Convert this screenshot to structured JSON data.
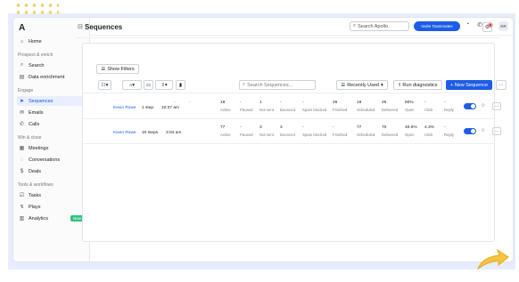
{
  "sidebar": {
    "logo": "A",
    "home": "Home",
    "sections": {
      "prospect": "Prospect & enrich",
      "engage": "Engage",
      "winclose": "Win & close",
      "tools": "Tools & workflows"
    },
    "items": {
      "search": "Search",
      "data_enrichment": "Data enrichment",
      "sequences": "Sequences",
      "emails": "Emails",
      "calls": "Calls",
      "meetings": "Meetings",
      "conversations": "Conversations",
      "deals": "Deals",
      "tasks": "Tasks",
      "plays": "Plays",
      "analytics": "Analytics",
      "analytics_badge": "New"
    }
  },
  "topbar": {
    "search_placeholder": "Search Apollo",
    "invite_label": "Invite Teammates",
    "avatar_initials": "KR"
  },
  "page": {
    "title": "Sequences",
    "show_filters": "Show Filters",
    "search_placeholder": "Search Sequences...",
    "sort_label": "Recently Used",
    "run_diagnostics": "Run diagnostics",
    "new_sequence": "+ New Sequence",
    "more": "···"
  },
  "rows": [
    {
      "owner": "Kevin Rowe",
      "steps": "1 step",
      "time": "10:37 am",
      "active": "18",
      "paused": "-",
      "not_sent": "1",
      "bounced": "-",
      "spam_blocked": "-",
      "finished": "26",
      "scheduled": "19",
      "delivered": "26",
      "open": "50%",
      "click": "-",
      "reply": "-"
    },
    {
      "owner": "Kevin Rowe",
      "steps": "10 steps",
      "time": "3:04 am",
      "active": "77",
      "paused": "-",
      "not_sent": "3",
      "bounced": "3",
      "spam_blocked": "-",
      "finished": "-",
      "scheduled": "77",
      "delivered": "70",
      "open": "46.6%",
      "click": "4.3%",
      "reply": "-"
    }
  ],
  "column_labels": {
    "active": "Active",
    "paused": "Paused",
    "not_sent": "Not sent",
    "bounced": "Bounced",
    "spam_blocked": "Spam blocked",
    "finished": "Finished",
    "scheduled": "Scheduled",
    "delivered": "Delivered",
    "open": "Open",
    "click": "Click",
    "reply": "Reply"
  },
  "colors": {
    "accent": "#1d5ce6",
    "badge": "#2ec27e"
  }
}
